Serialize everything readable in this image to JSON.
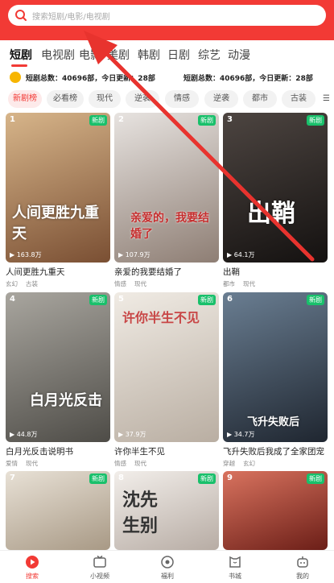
{
  "search": {
    "placeholder": "搜索短剧/电影/电视剧"
  },
  "tabs": [
    {
      "label": "短剧"
    },
    {
      "label": "电视剧"
    },
    {
      "label": "电影"
    },
    {
      "label": "美剧"
    },
    {
      "label": "韩剧"
    },
    {
      "label": "日剧"
    },
    {
      "label": "综艺"
    },
    {
      "label": "动漫"
    }
  ],
  "stats": {
    "left": "短剧总数：40696部，今日更新：28部",
    "right": "短剧总数：40696部，今日更新：28部"
  },
  "chips": [
    {
      "label": "新剧榜"
    },
    {
      "label": "必看榜"
    },
    {
      "label": "现代"
    },
    {
      "label": "逆袭"
    },
    {
      "label": "情感"
    },
    {
      "label": "逆袭"
    },
    {
      "label": "都市"
    },
    {
      "label": "古装"
    }
  ],
  "cards": [
    {
      "rank": "1",
      "badge": "新剧",
      "views": "163.8万",
      "title": "人间更胜九重天",
      "tags": [
        "玄幻",
        "古装"
      ],
      "poster_text": "人间更胜九重天",
      "color": "#b98a5a"
    },
    {
      "rank": "2",
      "badge": "新剧",
      "views": "107.9万",
      "title": "亲爱的我要结婚了",
      "tags": [
        "情感",
        "现代"
      ],
      "poster_text": "亲爱的，我要结婚了",
      "color": "#c9c4c3"
    },
    {
      "rank": "3",
      "badge": "新剧",
      "views": "64.1万",
      "title": "出鞘",
      "tags": [
        "都市",
        "现代"
      ],
      "poster_text": "出鞘",
      "color": "#2b2523"
    },
    {
      "rank": "4",
      "badge": "新剧",
      "views": "44.8万",
      "title": "白月光反击说明书",
      "tags": [
        "爱情",
        "现代"
      ],
      "poster_text": "白月光反击",
      "color": "#8c8a83"
    },
    {
      "rank": "5",
      "badge": "新剧",
      "views": "37.9万",
      "title": "许你半生不见",
      "tags": [
        "情感",
        "现代"
      ],
      "poster_text": "许你半生不见",
      "color": "#e4ddd6"
    },
    {
      "rank": "6",
      "badge": "新剧",
      "views": "34.7万",
      "title": "飞升失败后我成了全家团宠",
      "tags": [
        "穿越",
        "玄幻"
      ],
      "poster_text": "飞升失败后",
      "color": "#3b4a5a"
    },
    {
      "rank": "7",
      "badge": "新剧",
      "views": "",
      "title": "",
      "tags": [],
      "poster_text": "",
      "color": "#d6cfc4"
    },
    {
      "rank": "8",
      "badge": "新剧",
      "views": "",
      "title": "",
      "tags": [],
      "poster_text": "沈先生别",
      "color": "#e7e2dd"
    },
    {
      "rank": "9",
      "badge": "新剧",
      "views": "",
      "title": "",
      "tags": [],
      "poster_text": "",
      "color": "#b24a3e"
    }
  ],
  "bottom_nav": [
    {
      "label": "搜索",
      "icon": "play-circle-icon",
      "active": true
    },
    {
      "label": "小视频",
      "icon": "tv-icon",
      "active": false
    },
    {
      "label": "福利",
      "icon": "target-icon",
      "active": false
    },
    {
      "label": "书城",
      "icon": "book-icon",
      "active": false
    },
    {
      "label": "我的",
      "icon": "robot-icon",
      "active": false
    }
  ],
  "colors": {
    "accent": "#f23a35",
    "new_badge": "#19c06b"
  }
}
